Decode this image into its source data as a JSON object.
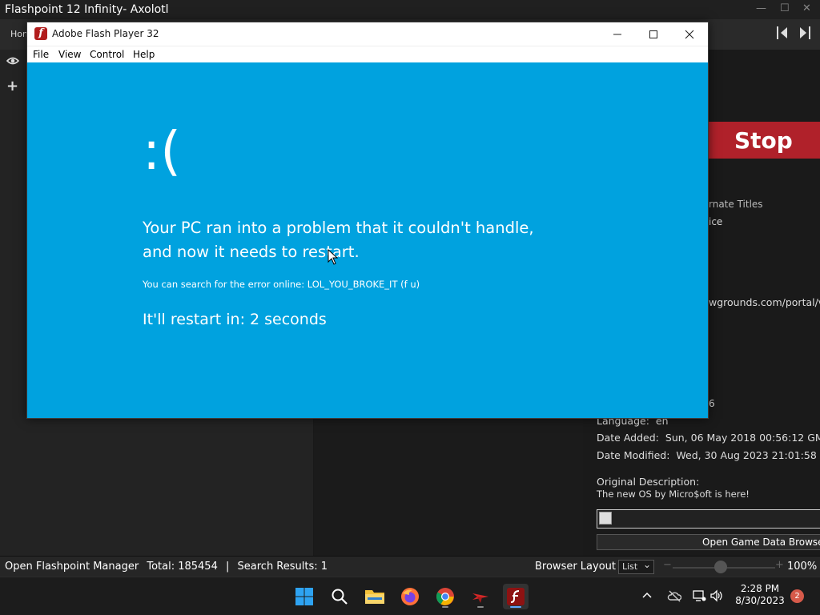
{
  "flashpoint": {
    "window_title": "Flashpoint 12 Infinity- Axolotl",
    "home_tab": "Hom",
    "stop_label": "Stop",
    "fragments": {
      "alternate_titles": "rnate Titles",
      "series": "ice",
      "source": "wgrounds.com/portal/vi",
      "release_date": "6"
    },
    "meta": {
      "language_label": "Language:",
      "language_value": "en",
      "date_added_label": "Date Added:",
      "date_added_value": "Sun, 06 May 2018 00:56:12 GMT",
      "date_modified_label": "Date Modified:",
      "date_modified_value": "Wed, 30 Aug 2023 21:01:58 GMT",
      "original_description_label": "Original Description:",
      "original_description_value": "The new OS by Micro$oft is here!"
    },
    "open_game_data_browser": "Open Game Data Browser",
    "statusbar": {
      "manager": "Open Flashpoint Manager",
      "total": "Total: 185454",
      "separator": "|",
      "results": "Search Results: 1",
      "browser_layout": "Browser Layout",
      "layout_value": "List",
      "zoom_minus": "−",
      "zoom_plus": "+",
      "zoom_level": 0.47,
      "zoom": "100%"
    }
  },
  "flash_player": {
    "title": "Adobe Flash Player 32",
    "menu": [
      "File",
      "View",
      "Control",
      "Help"
    ],
    "bsod": {
      "frown": ":(",
      "line1": "Your PC ran into a problem that it couldn't handle,",
      "line2": "and now it needs to restart.",
      "search": "You can search for the error online: LOL_YOU_BROKE_IT (f u)",
      "restart": "It'll restart in: 2 seconds"
    }
  },
  "taskbar": {
    "time": "2:28 PM",
    "date": "8/30/2023",
    "notification_count": "2",
    "icons": [
      "windows-start-icon",
      "search-icon",
      "file-explorer-icon",
      "firefox-icon",
      "chrome-icon",
      "launcher-icon",
      "flash-player-icon"
    ]
  },
  "colors": {
    "bsod_blue": "#00a2df",
    "stop_red": "#b0212a",
    "flash_red": "#b11d1d"
  }
}
